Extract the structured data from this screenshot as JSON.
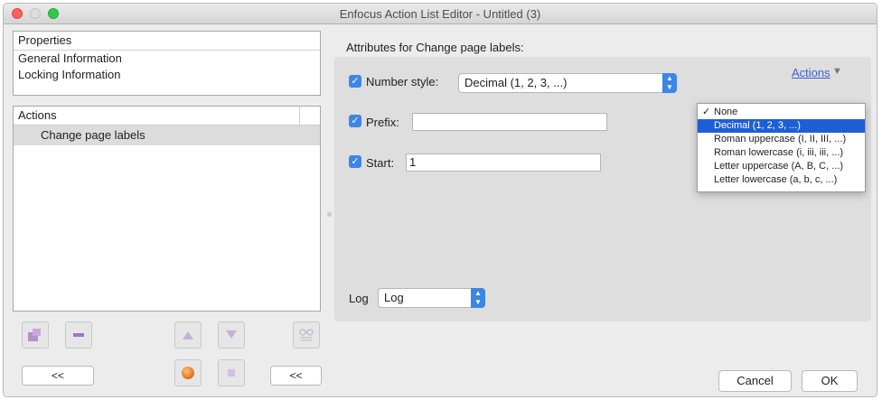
{
  "window": {
    "title": "Enfocus Action List Editor - Untitled (3)"
  },
  "properties": {
    "header": "Properties",
    "items": [
      "General Information",
      "Locking Information"
    ]
  },
  "actions_panel": {
    "header": "Actions",
    "items": [
      "Change page labels"
    ]
  },
  "left_buttons": {
    "back_left": "<<",
    "back_right": "<<"
  },
  "attributes": {
    "title": "Attributes for Change page labels:",
    "number_style": {
      "label": "Number style:",
      "value": "Decimal (1, 2, 3, ...)",
      "checked": true
    },
    "prefix": {
      "label": "Prefix:",
      "value": "",
      "checked": true
    },
    "start": {
      "label": "Start:",
      "value": "1",
      "checked": true
    },
    "log": {
      "label": "Log",
      "value": "Log"
    },
    "actions_link": "Actions"
  },
  "dropdown": {
    "options": [
      "None",
      "Decimal (1, 2, 3, ...)",
      "Roman uppercase (I, II, III, ...)",
      "Roman lowercase (i, iii, iii, ...)",
      "Letter uppercase (A, B, C, ...)",
      "Letter lowercase (a, b, c, ...)"
    ],
    "checked_index": 0,
    "highlighted_index": 1
  },
  "footer": {
    "cancel": "Cancel",
    "ok": "OK"
  },
  "icons": [
    "close-icon",
    "minimize-icon",
    "maximize-icon",
    "add-action-icon",
    "remove-action-icon",
    "move-up-icon",
    "move-down-icon",
    "glasses-icon",
    "record-icon",
    "stop-icon",
    "check-icon",
    "popup-arrows-icon",
    "caret-down-icon"
  ],
  "colors": {
    "accent": "#3d86e6",
    "highlight": "#1e5fd7",
    "record": "#e8781a",
    "link": "#3a5fd0"
  }
}
